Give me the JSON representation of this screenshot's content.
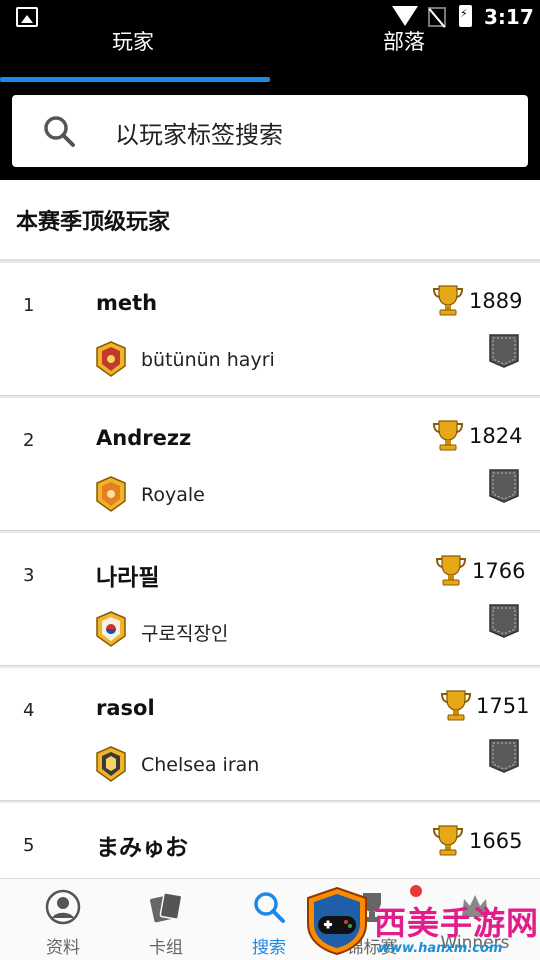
{
  "status_bar": {
    "time": "3:17"
  },
  "tabs": [
    {
      "label": "玩家",
      "active": true
    },
    {
      "label": "部落",
      "active": false
    }
  ],
  "search": {
    "placeholder": "以玩家标签搜索"
  },
  "section_title": "本赛季顶级玩家",
  "players": [
    {
      "rank": "1",
      "name": "meth",
      "trophies": "1889",
      "clan": "bütünün hayri"
    },
    {
      "rank": "2",
      "name": "Andrezz",
      "trophies": "1824",
      "clan": "Royale"
    },
    {
      "rank": "3",
      "name": "나라필",
      "trophies": "1766",
      "clan": "구로직장인"
    },
    {
      "rank": "4",
      "name": "rasol",
      "trophies": "1751",
      "clan": "Chelsea iran"
    },
    {
      "rank": "5",
      "name": "まみゅお",
      "trophies": "1665",
      "clan": ""
    }
  ],
  "bottom_nav": [
    {
      "label": "资料",
      "icon": "profile-icon"
    },
    {
      "label": "卡组",
      "icon": "cards-icon"
    },
    {
      "label": "搜索",
      "icon": "search-icon",
      "active": true
    },
    {
      "label": "锦标赛",
      "icon": "tournament-icon",
      "badge": true
    },
    {
      "label": "Winners",
      "icon": "winners-icon"
    }
  ],
  "watermark": {
    "text": "西美手游网",
    "url": "www.hanxm.com"
  },
  "colors": {
    "accent": "#1e88e5",
    "trophy": "#e6a817",
    "watermark_pink": "#e11d8a"
  }
}
